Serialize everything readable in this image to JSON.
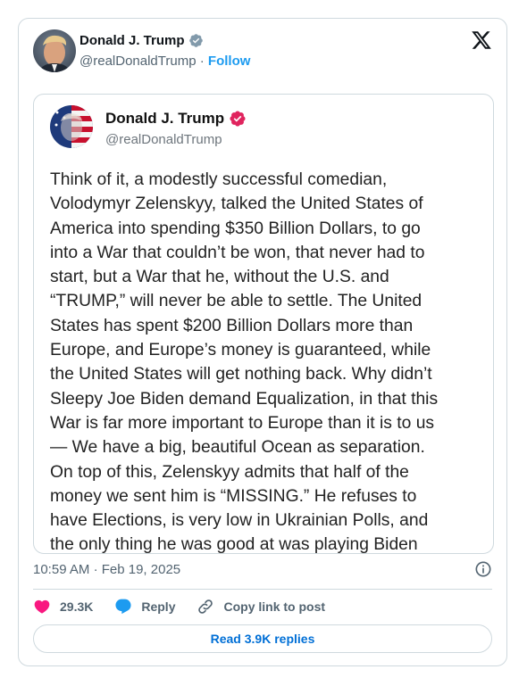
{
  "author": {
    "name": "Donald J. Trump",
    "handle": "@realDonaldTrump",
    "separator": "·",
    "follow_label": "Follow"
  },
  "embed": {
    "name": "Donald J. Trump",
    "handle": "@realDonaldTrump",
    "lines": [
      "Think of it, a modestly successful comedian,",
      "Volodymyr Zelenskyy, talked the United States of",
      "America into spending $350 Billion Dollars, to go",
      "into a War that couldn’t be won, that never had to",
      "start, but a War that he, without the U.S. and",
      "“TRUMP,” will never be able to settle. The United",
      "States has spent $200 Billion Dollars more than",
      "Europe, and Europe’s money is guaranteed, while",
      "the United States will get nothing back. Why didn’t",
      "Sleepy Joe Biden demand Equalization, in that this",
      "War is far more important to Europe than it is to us",
      "— We have a big, beautiful Ocean as separation.",
      "On top of this, Zelenskyy admits that half of the",
      "money we sent him is “MISSING.” He refuses to",
      "have Elections, is very low in Ukrainian Polls, and",
      "the only thing he was good at was playing Biden"
    ]
  },
  "meta": {
    "time": "10:59 AM",
    "separator": "·",
    "date": "Feb 19, 2025"
  },
  "actions": {
    "likes": "29.3K",
    "reply_label": "Reply",
    "copy_label": "Copy link to post"
  },
  "replies_button": "Read 3.9K replies",
  "colors": {
    "accent": "#1d9bf0",
    "like": "#f91880",
    "verified_embed": "#e0245e",
    "verified_author": "#829aab"
  },
  "icons": [
    "x-logo-icon",
    "verified-badge-icon",
    "info-icon",
    "heart-icon",
    "reply-bubble-icon",
    "link-icon"
  ]
}
